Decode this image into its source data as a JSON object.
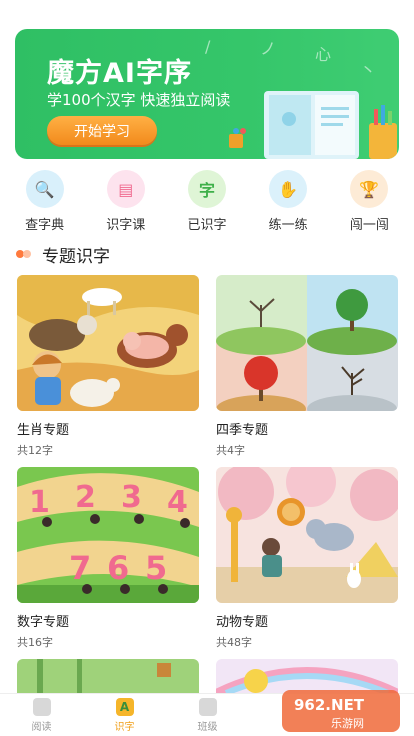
{
  "banner": {
    "title": "魔方AI字序",
    "subtitle": "学100个汉字 快速独立阅读",
    "button": "开始学习"
  },
  "quicknav": [
    {
      "label": "查字典",
      "icon": "dictionary-icon",
      "glyph": "🔍",
      "bg": "#d9f0fb",
      "fg": "#2f9ad8"
    },
    {
      "label": "识字课",
      "icon": "lesson-book-icon",
      "glyph": "▤",
      "bg": "#fde3ee",
      "fg": "#f06a8f"
    },
    {
      "label": "已识字",
      "icon": "learned-char-icon",
      "glyph": "字",
      "bg": "#dff5d6",
      "fg": "#3fb04a"
    },
    {
      "label": "练一练",
      "icon": "practice-hand-icon",
      "glyph": "✋",
      "bg": "#dbf1fb",
      "fg": "#f0a040"
    },
    {
      "label": "闯一闯",
      "icon": "trophy-icon",
      "glyph": "🏆",
      "bg": "#fdebd6",
      "fg": "#f09a2a"
    }
  ],
  "section": {
    "title": "专题识字"
  },
  "topics": [
    {
      "name": "生肖专题",
      "count": "共12字"
    },
    {
      "name": "四季专题",
      "count": "共4字"
    },
    {
      "name": "数字专题",
      "count": "共16字"
    },
    {
      "name": "动物专题",
      "count": "共48字"
    }
  ],
  "digits": [
    "1",
    "2",
    "3",
    "4",
    "7",
    "6",
    "5"
  ],
  "tabs": [
    {
      "label": "阅读",
      "active": false
    },
    {
      "label": "识字",
      "active": true
    },
    {
      "label": "班级",
      "active": false
    }
  ],
  "watermark": {
    "brand": "962.NET",
    "sub": "乐游网"
  }
}
